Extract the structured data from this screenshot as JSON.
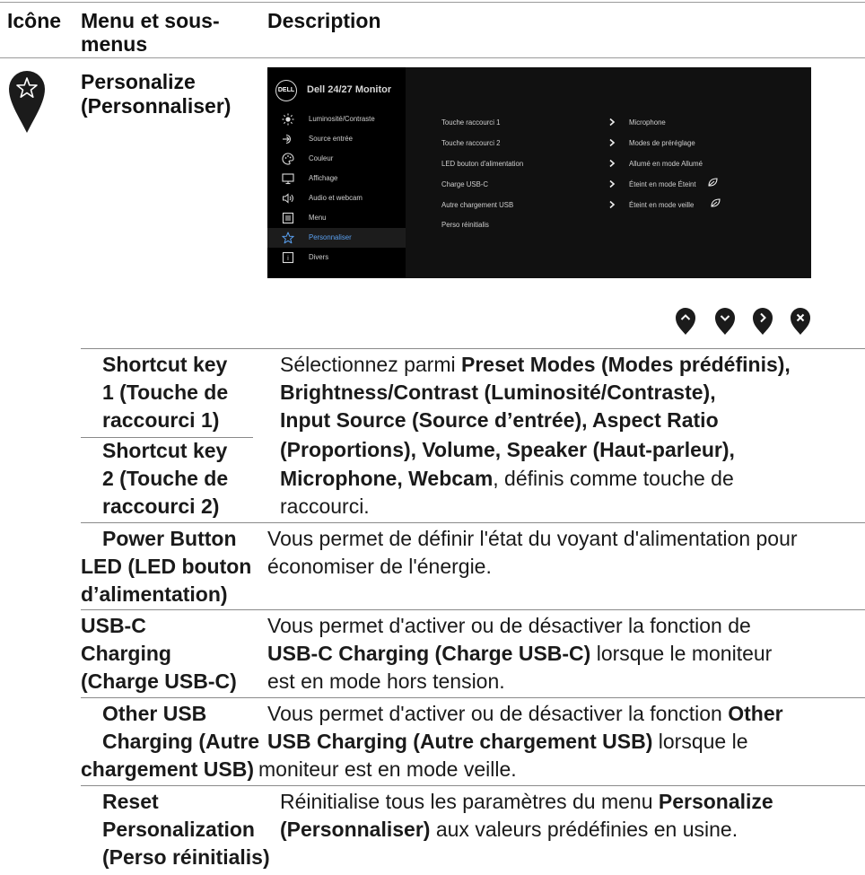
{
  "header": {
    "col_icon": "Icône",
    "col_menu_line1": "Menu et sous-",
    "col_menu_line2": "menus",
    "col_desc": "Description"
  },
  "section": {
    "icon": "star-icon",
    "title_line1": "Personalize",
    "title_line2": "(Personnaliser)"
  },
  "osd": {
    "logo": "DELL",
    "title": "Dell 24/27 Monitor",
    "menu": [
      {
        "label": "Luminosité/Contraste",
        "icon": "brightness-icon"
      },
      {
        "label": "Source entrée",
        "icon": "input-source-icon"
      },
      {
        "label": "Couleur",
        "icon": "color-icon"
      },
      {
        "label": "Affichage",
        "icon": "display-icon"
      },
      {
        "label": "Audio et webcam",
        "icon": "audio-icon"
      },
      {
        "label": "Menu",
        "icon": "menu-icon"
      },
      {
        "label": "Personnaliser",
        "icon": "star-icon",
        "selected": true
      },
      {
        "label": "Divers",
        "icon": "others-icon"
      }
    ],
    "settings": [
      {
        "name": "Touche raccourci 1",
        "value": "Microphone"
      },
      {
        "name": "Touche raccourci 2",
        "value": "Modes de préréglage"
      },
      {
        "name": "LED bouton d'alimentation",
        "value": "Allumé en mode Allumé"
      },
      {
        "name": "Charge USB-C",
        "value": "Éteint en mode Éteint"
      },
      {
        "name": "Autre chargement USB",
        "value": "Éteint en mode veille"
      },
      {
        "name": "Perso réinitialis",
        "value": ""
      }
    ],
    "accent_color": "#5aa0f0"
  },
  "nav_buttons": [
    "up-icon",
    "down-icon",
    "right-icon",
    "close-icon"
  ],
  "rows": {
    "shortcut1": {
      "l1": "Shortcut key",
      "l2": "1 (Touche de",
      "l3": "raccourci 1)"
    },
    "shortcut2": {
      "l1": "Shortcut key",
      "l2": "2 (Touche de",
      "l3": "raccourci 2)"
    },
    "shortcut_desc": {
      "prefix": "Sélectionnez parmi ",
      "b1": "Preset Modes (Modes prédéfinis),",
      "b2": "Brightness/Contrast (Luminosité/Contraste),",
      "b3": "Input Source (Source d’entrée), Aspect Ratio",
      "b4": "(Proportions), Volume, Speaker (Haut-parleur),",
      "b5": "Microphone, Webcam",
      "suffix": ", définis comme touche de",
      "last": "raccourci."
    },
    "power_led": {
      "l1": "Power Button",
      "l2": "LED (LED bouton",
      "l3": "d’alimentation)",
      "d1": "Vous permet de définir l'état du voyant d'alimentation pour",
      "d2": "économiser de l'énergie."
    },
    "usbc": {
      "l1": "USB-C",
      "l2": "Charging",
      "l3": "(Charge USB-C)",
      "d1": "Vous permet d'activer ou de désactiver la fonction de",
      "d2b": "USB-C Charging (Charge USB-C)",
      "d2": " lorsque le moniteur",
      "d3": "est en mode hors tension."
    },
    "other_usb": {
      "l1": "Other USB",
      "l2": "Charging (Autre",
      "l3": "chargement USB)",
      "d1": "Vous permet d'activer ou de désactiver la fonction ",
      "d1b": "Other",
      "d2b": "USB Charging (Autre chargement USB)",
      "d2": " lorsque le",
      "d3": "moniteur est en mode veille."
    },
    "reset": {
      "l1": "Reset",
      "l2": "Personalization",
      "l3": "(Perso réinitialis)",
      "d1": "Réinitialise tous les paramètres du menu ",
      "d1b": "Personalize",
      "d2b": "(Personnaliser)",
      "d2": " aux valeurs prédéfinies en usine."
    }
  }
}
